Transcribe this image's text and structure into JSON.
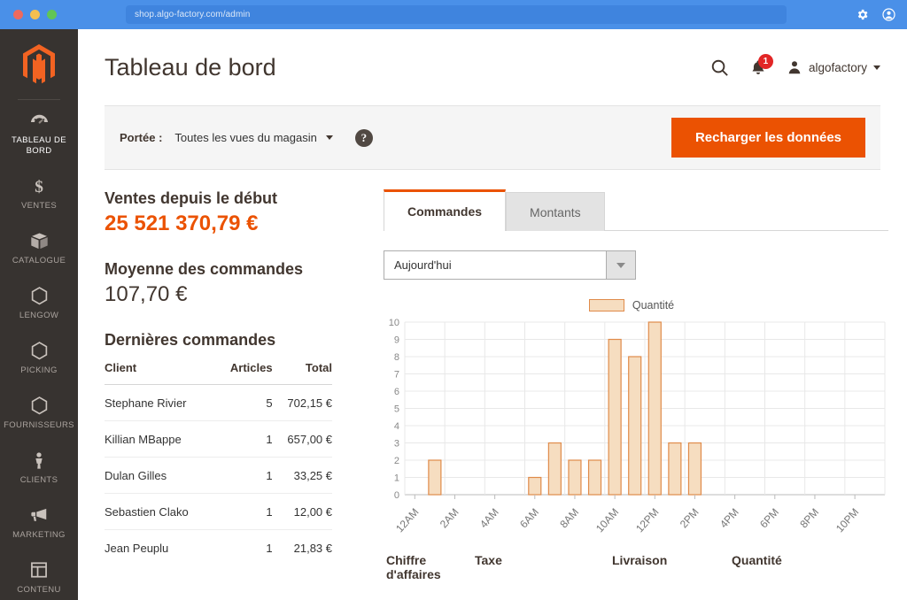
{
  "browser": {
    "url": "shop.algo-factory.com/admin",
    "icons": [
      "gear-icon",
      "account-icon"
    ]
  },
  "sidebar": {
    "logo": "magento-logo",
    "items": [
      {
        "label": "Tableau de bord",
        "icon": "dashboard-gauge-icon",
        "active": true
      },
      {
        "label": "Ventes",
        "icon": "dollar-icon",
        "active": false
      },
      {
        "label": "Catalogue",
        "icon": "box-icon",
        "active": false
      },
      {
        "label": "Lengow",
        "icon": "hexagon-icon",
        "active": false
      },
      {
        "label": "Picking",
        "icon": "hexagon-icon",
        "active": false
      },
      {
        "label": "Fournisseurs",
        "icon": "hexagon-icon",
        "active": false
      },
      {
        "label": "Clients",
        "icon": "person-icon",
        "active": false
      },
      {
        "label": "Marketing",
        "icon": "megaphone-icon",
        "active": false
      },
      {
        "label": "Contenu",
        "icon": "layout-icon",
        "active": false
      }
    ]
  },
  "header": {
    "title": "Tableau de bord",
    "search_icon": "search-icon",
    "notification_icon": "bell-icon",
    "notification_count": "1",
    "user_icon": "user-avatar-icon",
    "user_name": "algofactory"
  },
  "scope_bar": {
    "label": "Portée :",
    "value": "Toutes les vues du magasin",
    "help_icon": "?",
    "reload_button": "Recharger les données"
  },
  "stats": {
    "lifetime_sales_title": "Ventes depuis le début",
    "lifetime_sales_value": "25 521 370,79 €",
    "average_order_title": "Moyenne des commandes",
    "average_order_value": "107,70 €"
  },
  "last_orders": {
    "title": "Dernières commandes",
    "columns": [
      "Client",
      "Articles",
      "Total"
    ],
    "rows": [
      {
        "client": "Stephane Rivier",
        "articles": "5",
        "total": "702,15 €"
      },
      {
        "client": "Killian MBappe",
        "articles": "1",
        "total": "657,00 €"
      },
      {
        "client": "Dulan Gilles",
        "articles": "1",
        "total": "33,25 €"
      },
      {
        "client": "Sebastien Clako",
        "articles": "1",
        "total": "12,00 €"
      },
      {
        "client": "Jean Peuplu",
        "articles": "1",
        "total": "21,83 €"
      }
    ]
  },
  "tabs": [
    {
      "label": "Commandes",
      "active": true
    },
    {
      "label": "Montants",
      "active": false
    }
  ],
  "period": {
    "value": "Aujourd'hui",
    "arrow_icon": "chevron-down-icon"
  },
  "totals": {
    "columns": [
      "Chiffre d'affaires",
      "Taxe",
      "Livraison",
      "Quantité"
    ]
  },
  "colors": {
    "accent": "#eb5202",
    "sidebar_bg": "#373330",
    "bar_fill": "#f6ddc0",
    "bar_stroke": "#e08b4a",
    "badge_red": "#e22626",
    "chrome_blue": "#4a90e8"
  },
  "chart_data": {
    "type": "bar",
    "title": "",
    "legend": [
      "Quantité"
    ],
    "legend_position": "top-center",
    "xlabel": "",
    "ylabel": "",
    "ylim": [
      0,
      10
    ],
    "yticks": [
      0,
      1,
      2,
      3,
      4,
      5,
      6,
      7,
      8,
      9,
      10
    ],
    "grid": true,
    "xtick_labels": [
      "12AM",
      "2AM",
      "4AM",
      "6AM",
      "8AM",
      "10AM",
      "12PM",
      "2PM",
      "4PM",
      "6PM",
      "8PM",
      "10PM"
    ],
    "categories": [
      "12AM",
      "1AM",
      "2AM",
      "3AM",
      "4AM",
      "5AM",
      "6AM",
      "7AM",
      "8AM",
      "9AM",
      "10AM",
      "11AM",
      "12PM",
      "1PM",
      "2PM",
      "3PM",
      "4PM",
      "5PM",
      "6PM",
      "7PM",
      "8PM",
      "9PM",
      "10PM",
      "11PM"
    ],
    "series": [
      {
        "name": "Quantité",
        "values": [
          0,
          2,
          0,
          0,
          0,
          0,
          1,
          3,
          2,
          2,
          9,
          8,
          10,
          3,
          3,
          0,
          0,
          0,
          0,
          0,
          0,
          0,
          0,
          0
        ]
      }
    ]
  }
}
